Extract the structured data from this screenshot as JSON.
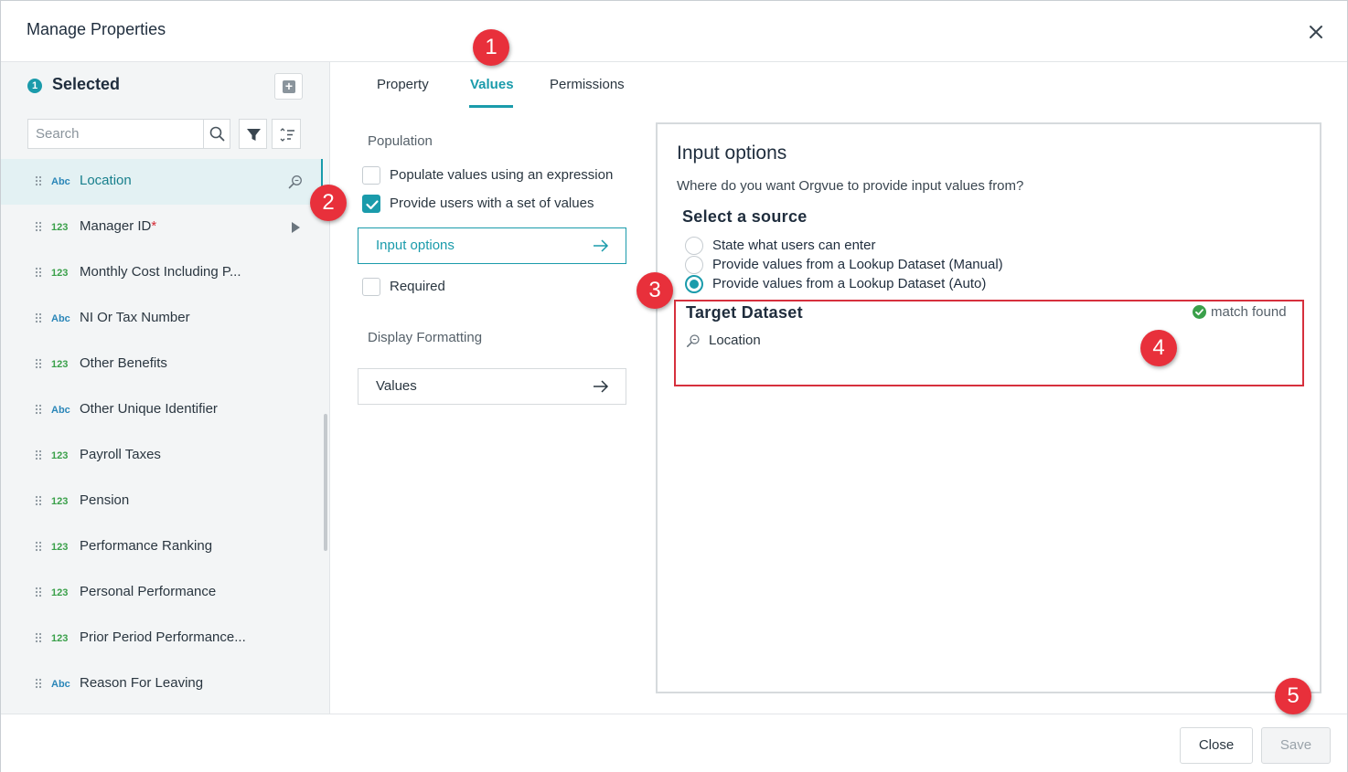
{
  "dialog": {
    "title": "Manage Properties",
    "close_icon": "close-icon"
  },
  "left_panel": {
    "selected_count": "1",
    "selected_title": "Selected",
    "add_icon": "plus-square-icon",
    "search_placeholder": "Search",
    "filter_icon": "filter-icon",
    "sort_icon": "sort-icon",
    "items": [
      {
        "type": "Abc",
        "name": "Location",
        "required": "",
        "active": true,
        "action_icon": "lookup-icon"
      },
      {
        "type": "123",
        "name": "Manager ID",
        "required": "*",
        "active": false,
        "action_icon": "play-arrow-icon"
      },
      {
        "type": "123",
        "name": "Monthly Cost Including P...",
        "required": "",
        "active": false,
        "action_icon": ""
      },
      {
        "type": "Abc",
        "name": "NI Or Tax Number",
        "required": "",
        "active": false,
        "action_icon": ""
      },
      {
        "type": "123",
        "name": "Other Benefits",
        "required": "",
        "active": false,
        "action_icon": ""
      },
      {
        "type": "Abc",
        "name": "Other Unique Identifier",
        "required": "",
        "active": false,
        "action_icon": ""
      },
      {
        "type": "123",
        "name": "Payroll Taxes",
        "required": "",
        "active": false,
        "action_icon": ""
      },
      {
        "type": "123",
        "name": "Pension",
        "required": "",
        "active": false,
        "action_icon": ""
      },
      {
        "type": "123",
        "name": "Performance Ranking",
        "required": "",
        "active": false,
        "action_icon": ""
      },
      {
        "type": "123",
        "name": "Personal Performance",
        "required": "",
        "active": false,
        "action_icon": ""
      },
      {
        "type": "123",
        "name": "Prior Period Performance...",
        "required": "",
        "active": false,
        "action_icon": ""
      },
      {
        "type": "Abc",
        "name": "Reason For Leaving",
        "required": "",
        "active": false,
        "action_icon": ""
      }
    ]
  },
  "tabs": [
    {
      "label": "Property",
      "active": false
    },
    {
      "label": "Values",
      "active": true
    },
    {
      "label": "Permissions",
      "active": false
    }
  ],
  "config": {
    "population_label": "Population",
    "populate_expression_label": "Populate values using an expression",
    "populate_expression_checked": false,
    "provide_set_label": "Provide users with a set of values",
    "provide_set_checked": true,
    "input_options_button": "Input options",
    "required_label": "Required",
    "required_checked": false,
    "display_formatting_label": "Display Formatting",
    "values_button": "Values"
  },
  "input_options": {
    "title": "Input options",
    "description": "Where do you want Orgvue to provide input values from?",
    "source_title": "Select a source",
    "sources": [
      {
        "label": "State what users can enter",
        "checked": false
      },
      {
        "label": "Provide values from a Lookup Dataset (Manual)",
        "checked": false
      },
      {
        "label": "Provide values from a Lookup Dataset (Auto)",
        "checked": true
      }
    ],
    "target_title": "Target Dataset",
    "match_status": "match found",
    "target_value": "Location"
  },
  "footer": {
    "close_label": "Close",
    "save_label": "Save"
  },
  "callouts": [
    "1",
    "2",
    "3",
    "4",
    "5"
  ],
  "colors": {
    "accent": "#1a9bab",
    "callout": "#e8303b",
    "highlight_border": "#d6303d",
    "success": "#3aa04a"
  }
}
